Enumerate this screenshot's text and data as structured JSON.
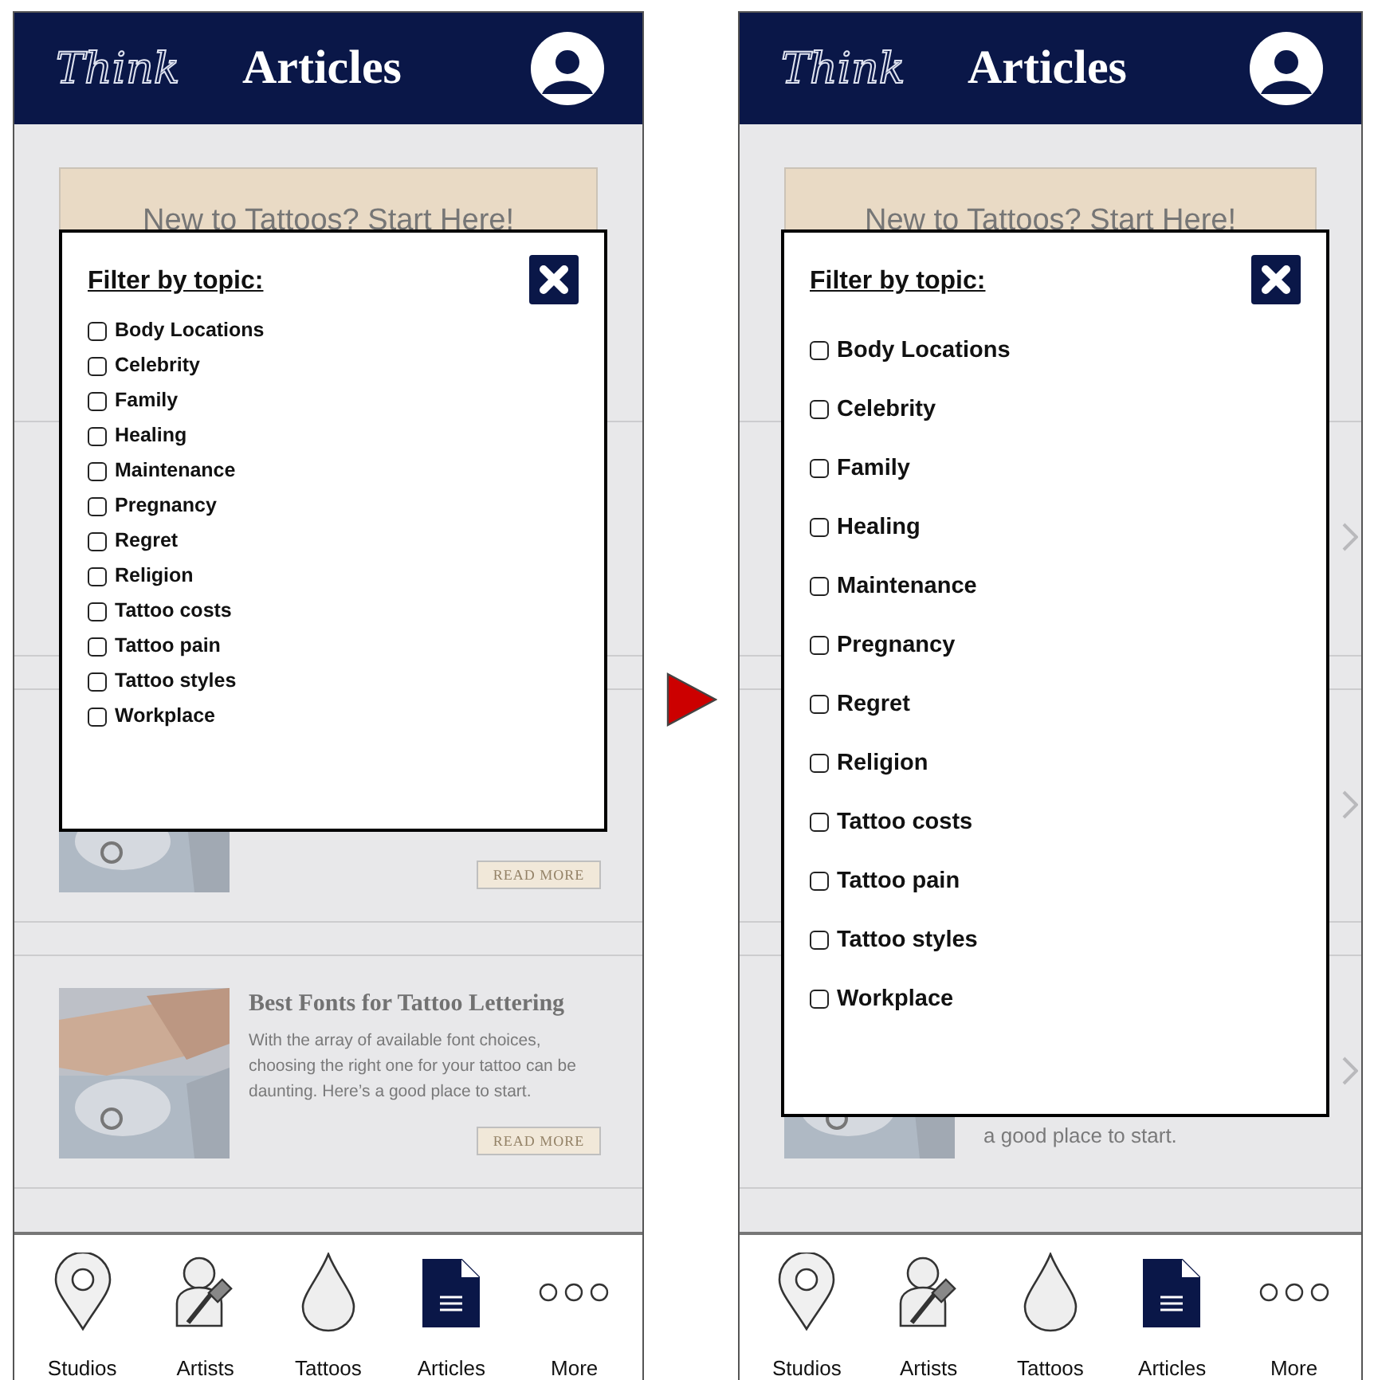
{
  "panels": [
    {
      "kind": "compact",
      "header": {
        "logo": "Think",
        "title": "Articles"
      },
      "banner": "New to Tattoos? Start Here!",
      "articles": [
        {
          "chevron": false
        },
        {
          "chevron": false,
          "has_picture": true,
          "read_more": "READ MORE"
        },
        {
          "chevron": false,
          "has_picture": true,
          "title": "Best Fonts for Tattoo Lettering",
          "body": "With the array of available font choices, choosing the right one for your tattoo can be daunting. Here’s a good place to start.",
          "read_more": "READ MORE"
        }
      ],
      "modal": {
        "title": "Filter by topic:",
        "topics": [
          {
            "label": "Body Locations",
            "checked": false
          },
          {
            "label": "Celebrity",
            "checked": false
          },
          {
            "label": "Family",
            "checked": false
          },
          {
            "label": "Healing",
            "checked": false
          },
          {
            "label": "Maintenance",
            "checked": false
          },
          {
            "label": "Pregnancy",
            "checked": false
          },
          {
            "label": "Regret",
            "checked": false
          },
          {
            "label": "Religion",
            "checked": false
          },
          {
            "label": "Tattoo costs",
            "checked": false
          },
          {
            "label": "Tattoo pain",
            "checked": false
          },
          {
            "label": "Tattoo styles",
            "checked": false
          },
          {
            "label": "Workplace",
            "checked": false
          }
        ]
      },
      "nav": [
        {
          "label": "Studios",
          "selected": false
        },
        {
          "label": "Artists",
          "selected": false
        },
        {
          "label": "Tattoos",
          "selected": false
        },
        {
          "label": "Articles",
          "selected": true
        },
        {
          "label": "More",
          "selected": false
        }
      ]
    },
    {
      "kind": "spaced",
      "header": {
        "logo": "Think",
        "title": "Articles"
      },
      "banner": "New to Tattoos? Start Here!",
      "articles": [
        {
          "chevron": true
        },
        {
          "chevron": true
        },
        {
          "chevron": true,
          "has_picture": true,
          "body": "a good place to start."
        }
      ],
      "modal": {
        "title": "Filter by topic:",
        "topics": [
          {
            "label": "Body Locations",
            "checked": false
          },
          {
            "label": "Celebrity",
            "checked": false
          },
          {
            "label": "Family",
            "checked": false
          },
          {
            "label": "Healing",
            "checked": false
          },
          {
            "label": "Maintenance",
            "checked": false
          },
          {
            "label": "Pregnancy",
            "checked": false
          },
          {
            "label": "Regret",
            "checked": false
          },
          {
            "label": "Religion",
            "checked": false
          },
          {
            "label": "Tattoo costs",
            "checked": false
          },
          {
            "label": "Tattoo pain",
            "checked": false
          },
          {
            "label": "Tattoo styles",
            "checked": false
          },
          {
            "label": "Workplace",
            "checked": false
          }
        ]
      },
      "nav": [
        {
          "label": "Studios",
          "selected": false
        },
        {
          "label": "Artists",
          "selected": false
        },
        {
          "label": "Tattoos",
          "selected": false
        },
        {
          "label": "Articles",
          "selected": true
        },
        {
          "label": "More",
          "selected": false
        }
      ]
    }
  ]
}
